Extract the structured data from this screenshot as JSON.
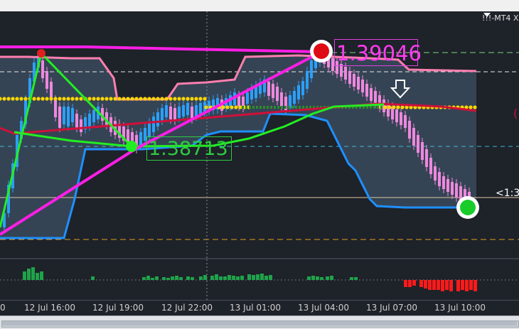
{
  "window": {
    "indicator_label": "!!!-MT4 X",
    "high_price_label": "1.39046",
    "low_price_label": "1.38713",
    "right_price_label": "<1:3",
    "right_red_label": "("
  },
  "time_axis": {
    "labels": [
      "0",
      "12 Jul 16:00",
      "12 Jul 19:00",
      "12 Jul 22:00",
      "13 Jul 01:00",
      "13 Jul 04:00",
      "13 Jul 07:00",
      "13 Jul 10:00"
    ]
  },
  "colors": {
    "background": "#1e2229",
    "band_fill": "#3a4a5c",
    "band_upper": "#ff7fb0",
    "band_lower": "#1e90ff",
    "magenta_line": "#ff1ee6",
    "green_line": "#22ee22",
    "dotted_yellow": "#ffd700",
    "red_ma": "#d0103a",
    "bull_candle": "#2aa0ff",
    "bear_candle": "#ee88dd",
    "histogram_green": "#1fa34a",
    "histogram_red": "#ff1a1a"
  },
  "chart_data": {
    "type": "candlestick",
    "title": "",
    "x": [
      "12 Jul 16:00",
      "12 Jul 19:00",
      "12 Jul 22:00",
      "13 Jul 01:00",
      "13 Jul 04:00",
      "13 Jul 07:00",
      "13 Jul 10:00"
    ],
    "annotations": [
      {
        "text": "1.39046",
        "kind": "swing-high"
      },
      {
        "text": "1.38713",
        "kind": "swing-low"
      }
    ],
    "indicators": [
      "upper-band",
      "lower-band",
      "moving-average",
      "zigzag",
      "volume-histogram"
    ]
  }
}
